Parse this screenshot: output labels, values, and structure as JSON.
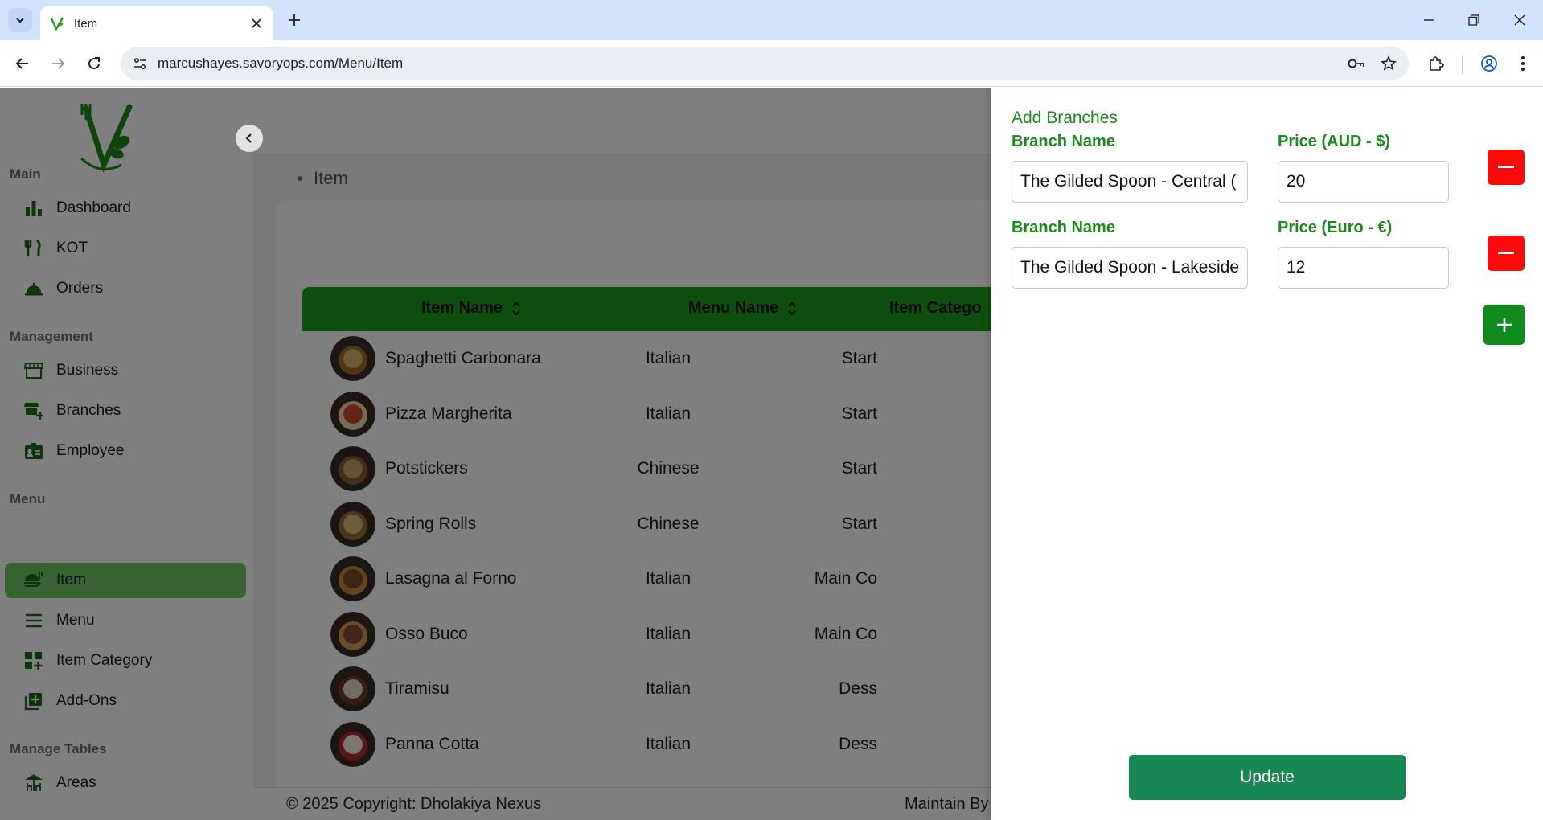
{
  "browser": {
    "tab_title": "Item",
    "url": "marcushayes.savoryops.com/Menu/Item"
  },
  "sidebar": {
    "sections": {
      "main": "Main",
      "management": "Management",
      "menu": "Menu",
      "manage_tables": "Manage Tables"
    },
    "items": {
      "dashboard": "Dashboard",
      "kot": "KOT",
      "orders": "Orders",
      "business": "Business",
      "branches": "Branches",
      "employee": "Employee",
      "item": "Item",
      "menu": "Menu",
      "item_category": "Item Category",
      "add_ons": "Add-Ons",
      "areas": "Areas"
    }
  },
  "breadcrumb": "Item",
  "table": {
    "headers": [
      "Item Name",
      "Menu Name",
      "Item Catego"
    ],
    "rows": [
      {
        "name": "Spaghetti Carbonara",
        "menu": "Italian",
        "category": "Start"
      },
      {
        "name": "Pizza Margherita",
        "menu": "Italian",
        "category": "Start"
      },
      {
        "name": "Potstickers",
        "menu": "Chinese",
        "category": "Start"
      },
      {
        "name": "Spring Rolls",
        "menu": "Chinese",
        "category": "Start"
      },
      {
        "name": "Lasagna al Forno",
        "menu": "Italian",
        "category": "Main Co"
      },
      {
        "name": "Osso Buco",
        "menu": "Italian",
        "category": "Main Co"
      },
      {
        "name": "Tiramisu",
        "menu": "Italian",
        "category": "Dess"
      },
      {
        "name": "Panna Cotta",
        "menu": "Italian",
        "category": "Dess"
      }
    ]
  },
  "footer": {
    "copyright": "© 2025 Copyright: Dholakiya Nexus",
    "maintain": "Maintain By"
  },
  "drawer": {
    "title": "Add Branches",
    "branches": [
      {
        "branch_label": "Branch Name",
        "branch_value": "The Gilded Spoon - Central (",
        "price_label": "Price (AUD - $)",
        "price_value": "20"
      },
      {
        "branch_label": "Branch Name",
        "branch_value": "The Gilded Spoon - Lakeside",
        "price_label": "Price (Euro - €)",
        "price_value": "12"
      }
    ],
    "update_label": "Update"
  },
  "colors": {
    "brand_green": "#1aa11a",
    "label_green": "#1a8a1a",
    "remove_red": "#ff0a0a",
    "update_green": "#198754",
    "active_nav": "#72c466"
  }
}
